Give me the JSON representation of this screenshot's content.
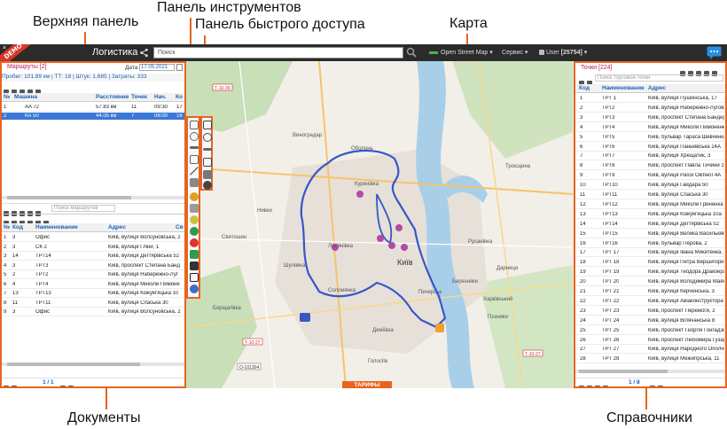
{
  "callouts": {
    "top_panel": "Верхняя панель",
    "tools_panel": "Панель инструментов",
    "quick_access_panel": "Панель быстрого доступа",
    "map": "Карта",
    "documents": "Документы",
    "directories": "Справочники"
  },
  "topbar": {
    "demo_badge": "DEMO",
    "app_title": "Логистика",
    "search_placeholder": "Поиск",
    "map_provider": "Open Street Map",
    "service_menu": "Сервис",
    "user_label": "User",
    "user_id": "[25754]"
  },
  "routes_panel": {
    "title": "Маршруты [2]",
    "date_label": "Дата",
    "date_value": "17.05.2021",
    "summary": {
      "mileage": "Пробег: 101.89 км",
      "tt": "ТТ: 18",
      "pieces": "Штук: 1,685",
      "costs": "Затраты: 333"
    },
    "columns": [
      "№",
      "Машина",
      "Расстояние",
      "Точек",
      "Нач.",
      "Ко"
    ],
    "rows": [
      {
        "num": "1",
        "car": "AA 72",
        "distance": "57.83 км",
        "points": "11",
        "start": "09:30",
        "end": "17"
      },
      {
        "num": "2",
        "car": "КА 50",
        "distance": "44.05 км",
        "points": "7",
        "start": "08:00",
        "end": "16"
      }
    ],
    "search_placeholder": "Поиск маршрутов"
  },
  "points_table": {
    "columns": [
      "№",
      "Код",
      "Наименование",
      "Адрес",
      "Св"
    ],
    "rows": [
      {
        "n": "1",
        "code": "3",
        "name": "Офис",
        "address": "Київ, вулиця Волсуновська, 2"
      },
      {
        "n": "2",
        "code": "3",
        "name": "СК 2",
        "address": "Київ, вулиця Гліни, 1"
      },
      {
        "n": "3",
        "code": "14",
        "name": "ТРТ14",
        "address": "Київ, вулиця Дегтярівська 52"
      },
      {
        "n": "4",
        "code": "3",
        "name": "ТРТ3",
        "address": "Київ, проспект Степана Банд"
      },
      {
        "n": "5",
        "code": "2",
        "name": "ТРТ2",
        "address": "Київ, вулиця Набережно-Луг"
      },
      {
        "n": "6",
        "code": "4",
        "name": "ТРТ4",
        "address": "Київ, вулиця Миколи Пимоне"
      },
      {
        "n": "7",
        "code": "13",
        "name": "ТРТ13",
        "address": "Київ, вулиця Кожум'яцька 10"
      },
      {
        "n": "8",
        "code": "11",
        "name": "ТРТ11",
        "address": "Київ, вулиця Спаська 30"
      },
      {
        "n": "9",
        "code": "3",
        "name": "Офис",
        "address": "Київ, вулиця Волсуновська, 2"
      }
    ],
    "pager": "1 / 1"
  },
  "directory_panel": {
    "title": "Точки [224]",
    "search_placeholder": "Поиск торговой точки",
    "columns": [
      "Код",
      "Наименование",
      "Адрес"
    ],
    "rows": [
      {
        "code": "1",
        "name": "ТРТ 1",
        "address": "Київ, вулиця Пушкінська, 17"
      },
      {
        "code": "2",
        "name": "ТРТ2",
        "address": "Київ, вулиця Набережно-Лугова 9"
      },
      {
        "code": "3",
        "name": "ТРТ3",
        "address": "Київ, проспект Степана Бандери"
      },
      {
        "code": "4",
        "name": "ТРТ4",
        "address": "Київ, вулиця Миколи Пимоненка"
      },
      {
        "code": "5",
        "name": "ТРТ5",
        "address": "Київ, бульвар Тараса Шевченка,"
      },
      {
        "code": "6",
        "name": "ТРТ6",
        "address": "Київ, вулиця Паньківська 14А"
      },
      {
        "code": "7",
        "name": "ТРТ7",
        "address": "Київ, вулиця Хрещатик, 3"
      },
      {
        "code": "8",
        "name": "ТРТ8",
        "address": "Київ, проспект Павла Тичини 18"
      },
      {
        "code": "9",
        "name": "ТРТ9",
        "address": "Київ, вулиця Раїси Окіпної 4А"
      },
      {
        "code": "10",
        "name": "ТРТ10",
        "address": "Київ, вулиця Гайдара 50"
      },
      {
        "code": "11",
        "name": "ТРТ11",
        "address": "Київ, вулиця Спаська 30"
      },
      {
        "code": "12",
        "name": "ТРТ12",
        "address": "Київ, вулиця Миколи Гриненка 4"
      },
      {
        "code": "13",
        "name": "ТРТ13",
        "address": "Київ, вулиця Кожум'яцька 10а"
      },
      {
        "code": "14",
        "name": "ТРТ14",
        "address": "Київ, вулиця Дегтярівська 52"
      },
      {
        "code": "15",
        "name": "ТРТ15",
        "address": "Київ, вулиця Велика Васильківсь"
      },
      {
        "code": "16",
        "name": "ТРТ16",
        "address": "Київ, бульвар Перова, 2"
      },
      {
        "code": "17",
        "name": "ТРТ 17",
        "address": "Київ, вулиця Івана Микитенка, 24"
      },
      {
        "code": "18",
        "name": "ТРТ 18",
        "address": "Київ, вулиця Петра Вершигори, 1"
      },
      {
        "code": "19",
        "name": "ТРТ 19",
        "address": "Київ, вулиця Теодора Драйзера,"
      },
      {
        "code": "20",
        "name": "ТРТ 20",
        "address": "Київ, вулиця Володимира Маяков"
      },
      {
        "code": "21",
        "name": "ТРТ 21",
        "address": "Київ, вулиця Керченська, 3"
      },
      {
        "code": "22",
        "name": "ТРТ 22",
        "address": "Київ, вулиця Авіаконструктора А"
      },
      {
        "code": "23",
        "name": "ТРТ 23",
        "address": "Київ, проспект Перемоги, 2"
      },
      {
        "code": "24",
        "name": "ТРТ 24",
        "address": "Київ, вулиця Вілячанська 8"
      },
      {
        "code": "25",
        "name": "ТРТ 25",
        "address": "Київ, проспект Георгія Гонгадзе,"
      },
      {
        "code": "26",
        "name": "ТРТ 26",
        "address": "Київ, проспект Любомира Гузара"
      },
      {
        "code": "27",
        "name": "ТРТ 27",
        "address": "Київ, вулиця Народного Ополчен"
      },
      {
        "code": "28",
        "name": "ТРТ 28",
        "address": "Київ, вулиця Межигірська, 11"
      }
    ],
    "pager": "1 / 8"
  },
  "map": {
    "city_label": "Київ",
    "districts": [
      "Оболонь",
      "Виноградар",
      "Куренівка",
      "Лук'янівка",
      "Святошин",
      "Шулявка",
      "Дарниця",
      "Позняки",
      "Харківський",
      "Голосіїв",
      "Деміївка",
      "Нивки",
      "Борщагівка",
      "Соломянка",
      "Печерськ",
      "Русанівка",
      "Троєщина",
      "Березняки"
    ],
    "road_labels": [
      "Т-10-39",
      "Т-10-27",
      "О-101304",
      "Т-10-27"
    ],
    "tariffs_tab": "ТАРИФЫ"
  },
  "colors": {
    "accent_orange": "#e8641e",
    "route_blue": "#3756c8",
    "topbar_dark": "#2b2b2b",
    "header_blue": "#1c5fb5",
    "title_pink": "#c2185b",
    "selected_row": "#3b78d6"
  }
}
